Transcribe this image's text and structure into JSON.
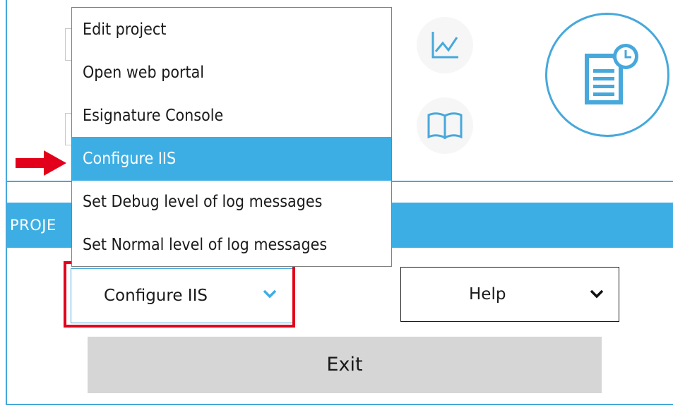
{
  "menu": {
    "items": [
      {
        "label": "Edit project"
      },
      {
        "label": "Open web portal"
      },
      {
        "label": "Esignature Console"
      },
      {
        "label": "Configure IIS",
        "selected": true
      },
      {
        "label": "Set Debug level of log messages"
      },
      {
        "label": "Set Normal level of log messages"
      }
    ]
  },
  "project_bar": {
    "label": "PROJE"
  },
  "action_combo": {
    "value": "Configure IIS"
  },
  "help_combo": {
    "value": "Help"
  },
  "exit_button": {
    "label": "Exit"
  },
  "colors": {
    "accent": "#3daee3",
    "highlight": "#e3001b",
    "exit_bg": "#d6d6d6"
  }
}
